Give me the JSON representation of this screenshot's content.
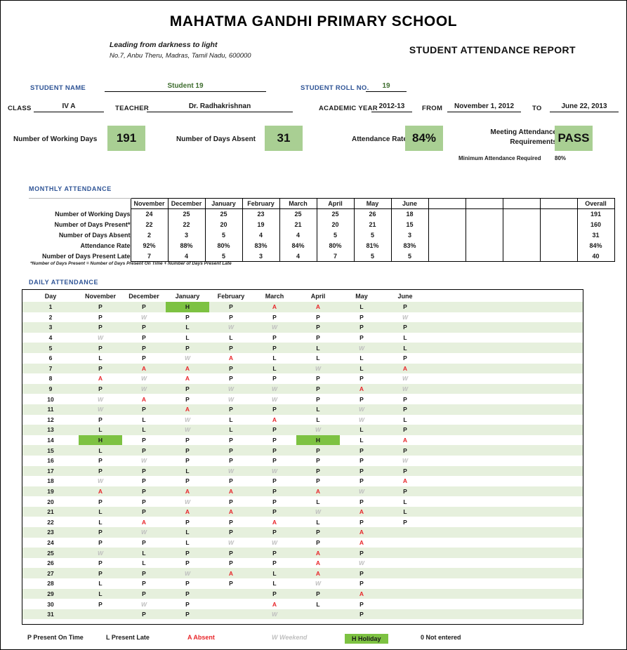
{
  "header": {
    "school_name": "MAHATMA GANDHI PRIMARY SCHOOL",
    "motto": "Leading from darkness to light",
    "address": "No.7, Anbu Theru, Madras, Tamil Nadu, 600000",
    "report_title": "STUDENT ATTENDANCE REPORT"
  },
  "fields": {
    "student_name_label": "STUDENT NAME",
    "student_name_value": "Student 19",
    "student_roll_label": "STUDENT ROLL NO.",
    "student_roll_value": "19",
    "class_label": "CLASS",
    "class_value": "IV A",
    "teacher_label": "TEACHER",
    "teacher_value": "Dr. Radhakrishnan",
    "academic_year_label": "ACADEMIC YEAR",
    "academic_year_value": "2012-13",
    "from_label": "FROM",
    "from_value": "November 1, 2012",
    "to_label": "TO",
    "to_value": "June 22, 2013"
  },
  "summary": {
    "working_days_label": "Number of Working Days",
    "working_days_value": "191",
    "days_absent_label": "Number of Days Absent",
    "days_absent_value": "31",
    "attendance_rate_label": "Attendance Rate",
    "attendance_rate_value": "84%",
    "meeting_req_label_line1": "Meeting Attendance",
    "meeting_req_label_line2": "Requirements",
    "meeting_req_value": "PASS",
    "min_required_label": "Minimum Attendance Required",
    "min_required_value": "80%",
    "box_color": "#a9cf93"
  },
  "sections": {
    "monthly_heading": "MONTHLY ATTENDANCE",
    "daily_heading": "DAILY ATTENDANCE",
    "monthly_footnote": "*Number of Days Present = Number of Days Present On Time + Number of Days Present Late"
  },
  "monthly": {
    "columns": [
      "November",
      "December",
      "January",
      "February",
      "March",
      "April",
      "May",
      "June",
      "",
      "",
      "",
      "",
      "Overall"
    ],
    "rows": [
      {
        "label": "Number of Working Days",
        "values": [
          "24",
          "25",
          "25",
          "23",
          "25",
          "25",
          "26",
          "18",
          "",
          "",
          "",
          "",
          "191"
        ]
      },
      {
        "label": "Number of Days Present*",
        "values": [
          "22",
          "22",
          "20",
          "19",
          "21",
          "20",
          "21",
          "15",
          "",
          "",
          "",
          "",
          "160"
        ]
      },
      {
        "label": "Number of Days Absent",
        "values": [
          "2",
          "3",
          "5",
          "4",
          "4",
          "5",
          "5",
          "3",
          "",
          "",
          "",
          "",
          "31"
        ]
      },
      {
        "label": "Attendance Rate",
        "values": [
          "92%",
          "88%",
          "80%",
          "83%",
          "84%",
          "80%",
          "81%",
          "83%",
          "",
          "",
          "",
          "",
          "84%"
        ]
      },
      {
        "label": "Number of Days Present Late",
        "values": [
          "7",
          "4",
          "5",
          "3",
          "4",
          "7",
          "5",
          "5",
          "",
          "",
          "",
          "",
          "40"
        ]
      }
    ]
  },
  "daily": {
    "day_header": "Day",
    "columns": [
      "November",
      "December",
      "January",
      "February",
      "March",
      "April",
      "May",
      "June"
    ],
    "rows": [
      {
        "day": "1",
        "marks": [
          "P",
          "P",
          "H",
          "P",
          "A",
          "A",
          "L",
          "P"
        ]
      },
      {
        "day": "2",
        "marks": [
          "P",
          "W",
          "P",
          "P",
          "P",
          "P",
          "P",
          "W"
        ]
      },
      {
        "day": "3",
        "marks": [
          "P",
          "P",
          "L",
          "W",
          "W",
          "P",
          "P",
          "P"
        ]
      },
      {
        "day": "4",
        "marks": [
          "W",
          "P",
          "L",
          "L",
          "P",
          "P",
          "P",
          "L"
        ]
      },
      {
        "day": "5",
        "marks": [
          "P",
          "P",
          "P",
          "P",
          "P",
          "L",
          "W",
          "L"
        ]
      },
      {
        "day": "6",
        "marks": [
          "L",
          "P",
          "W",
          "A",
          "L",
          "L",
          "L",
          "P"
        ]
      },
      {
        "day": "7",
        "marks": [
          "P",
          "A",
          "A",
          "P",
          "L",
          "W",
          "L",
          "A"
        ]
      },
      {
        "day": "8",
        "marks": [
          "A",
          "W",
          "A",
          "P",
          "P",
          "P",
          "P",
          "W"
        ]
      },
      {
        "day": "9",
        "marks": [
          "P",
          "W",
          "P",
          "W",
          "W",
          "P",
          "A",
          "W"
        ]
      },
      {
        "day": "10",
        "marks": [
          "W",
          "A",
          "P",
          "W",
          "W",
          "P",
          "P",
          "P"
        ]
      },
      {
        "day": "11",
        "marks": [
          "W",
          "P",
          "A",
          "P",
          "P",
          "L",
          "W",
          "P"
        ]
      },
      {
        "day": "12",
        "marks": [
          "P",
          "L",
          "W",
          "L",
          "A",
          "L",
          "W",
          "L"
        ]
      },
      {
        "day": "13",
        "marks": [
          "L",
          "L",
          "W",
          "L",
          "P",
          "W",
          "L",
          "P"
        ]
      },
      {
        "day": "14",
        "marks": [
          "H",
          "P",
          "P",
          "P",
          "P",
          "H",
          "L",
          "A"
        ]
      },
      {
        "day": "15",
        "marks": [
          "L",
          "P",
          "P",
          "P",
          "P",
          "P",
          "P",
          "P"
        ]
      },
      {
        "day": "16",
        "marks": [
          "P",
          "W",
          "P",
          "P",
          "P",
          "P",
          "P",
          "W"
        ]
      },
      {
        "day": "17",
        "marks": [
          "P",
          "P",
          "L",
          "W",
          "W",
          "P",
          "P",
          "P"
        ]
      },
      {
        "day": "18",
        "marks": [
          "W",
          "P",
          "P",
          "P",
          "P",
          "P",
          "P",
          "A"
        ]
      },
      {
        "day": "19",
        "marks": [
          "A",
          "P",
          "A",
          "A",
          "P",
          "A",
          "W",
          "P"
        ]
      },
      {
        "day": "20",
        "marks": [
          "P",
          "P",
          "W",
          "P",
          "P",
          "L",
          "P",
          "L"
        ]
      },
      {
        "day": "21",
        "marks": [
          "L",
          "P",
          "A",
          "A",
          "P",
          "W",
          "A",
          "L"
        ]
      },
      {
        "day": "22",
        "marks": [
          "L",
          "A",
          "P",
          "P",
          "A",
          "L",
          "P",
          "P"
        ]
      },
      {
        "day": "23",
        "marks": [
          "P",
          "W",
          "L",
          "P",
          "P",
          "P",
          "A",
          ""
        ]
      },
      {
        "day": "24",
        "marks": [
          "P",
          "P",
          "L",
          "W",
          "W",
          "P",
          "A",
          ""
        ]
      },
      {
        "day": "25",
        "marks": [
          "W",
          "L",
          "P",
          "P",
          "P",
          "A",
          "P",
          ""
        ]
      },
      {
        "day": "26",
        "marks": [
          "P",
          "L",
          "P",
          "P",
          "P",
          "A",
          "W",
          ""
        ]
      },
      {
        "day": "27",
        "marks": [
          "P",
          "P",
          "W",
          "A",
          "L",
          "A",
          "P",
          ""
        ]
      },
      {
        "day": "28",
        "marks": [
          "L",
          "P",
          "P",
          "P",
          "L",
          "W",
          "P",
          ""
        ]
      },
      {
        "day": "29",
        "marks": [
          "L",
          "P",
          "P",
          "",
          "P",
          "P",
          "A",
          ""
        ]
      },
      {
        "day": "30",
        "marks": [
          "P",
          "W",
          "P",
          "",
          "A",
          "L",
          "P",
          ""
        ]
      },
      {
        "day": "31",
        "marks": [
          "",
          "P",
          "P",
          "",
          "W",
          "",
          "P",
          ""
        ]
      }
    ]
  },
  "legend": {
    "items": [
      {
        "code": "P",
        "text": "P Present On Time",
        "kind": "present"
      },
      {
        "code": "L",
        "text": "L Present Late",
        "kind": "late"
      },
      {
        "code": "A",
        "text": "A Absent",
        "kind": "absent"
      },
      {
        "code": "W",
        "text": "W Weekend",
        "kind": "weekend"
      },
      {
        "code": "H",
        "text": "H Holiday",
        "kind": "holiday"
      },
      {
        "code": "0",
        "text": "0 Not entered",
        "kind": "none"
      }
    ],
    "colors": {
      "absent": "#e8262a",
      "weekend": "#bfbfbf",
      "holiday_bg": "#7dc242"
    }
  }
}
